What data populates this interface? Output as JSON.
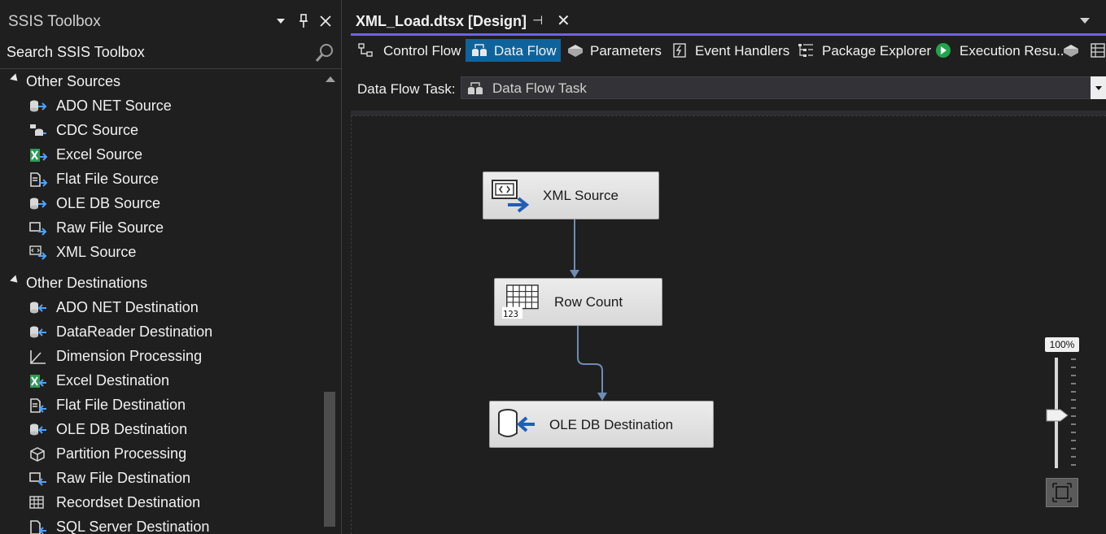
{
  "toolbox": {
    "title": "SSIS Toolbox",
    "search_placeholder": "Search SSIS Toolbox",
    "groups": [
      {
        "label": "Other Sources",
        "items": [
          "ADO NET Source",
          "CDC Source",
          "Excel Source",
          "Flat File Source",
          "OLE DB Source",
          "Raw File Source",
          "XML Source"
        ]
      },
      {
        "label": "Other Destinations",
        "items": [
          "ADO NET Destination",
          "DataReader Destination",
          "Dimension Processing",
          "Excel Destination",
          "Flat File Destination",
          "OLE DB Destination",
          "Partition Processing",
          "Raw File Destination",
          "Recordset Destination",
          "SQL Server Destination"
        ]
      }
    ]
  },
  "document": {
    "tab_title": "XML_Load.dtsx [Design]",
    "tab_pin_glyph": "⊣",
    "tab_close_glyph": "✕",
    "designer_tabs": [
      {
        "label": "Control Flow",
        "icon": "control-flow-icon"
      },
      {
        "label": "Data Flow",
        "icon": "data-flow-icon"
      },
      {
        "label": "Parameters",
        "icon": "parameters-icon"
      },
      {
        "label": "Event Handlers",
        "icon": "event-handlers-icon"
      },
      {
        "label": "Package Explorer",
        "icon": "package-explorer-icon"
      },
      {
        "label": "Execution Resu..",
        "icon": "execution-results-icon"
      }
    ],
    "active_tab": "Data Flow",
    "task_label": "Data Flow Task:",
    "task_value": "Data Flow Task",
    "nodes": [
      {
        "label": "XML Source",
        "icon": "xml-source-icon"
      },
      {
        "label": "Row Count",
        "icon": "row-count-icon"
      },
      {
        "label": "OLE DB Destination",
        "icon": "oledb-destination-icon"
      }
    ],
    "row_count_icon_text": "123",
    "zoom": "100%"
  },
  "colors": {
    "accent": "#7160e8",
    "active_tab_bg": "#0e639c",
    "connector": "#6e8cb5",
    "node_bg": "#e2e2e2"
  }
}
